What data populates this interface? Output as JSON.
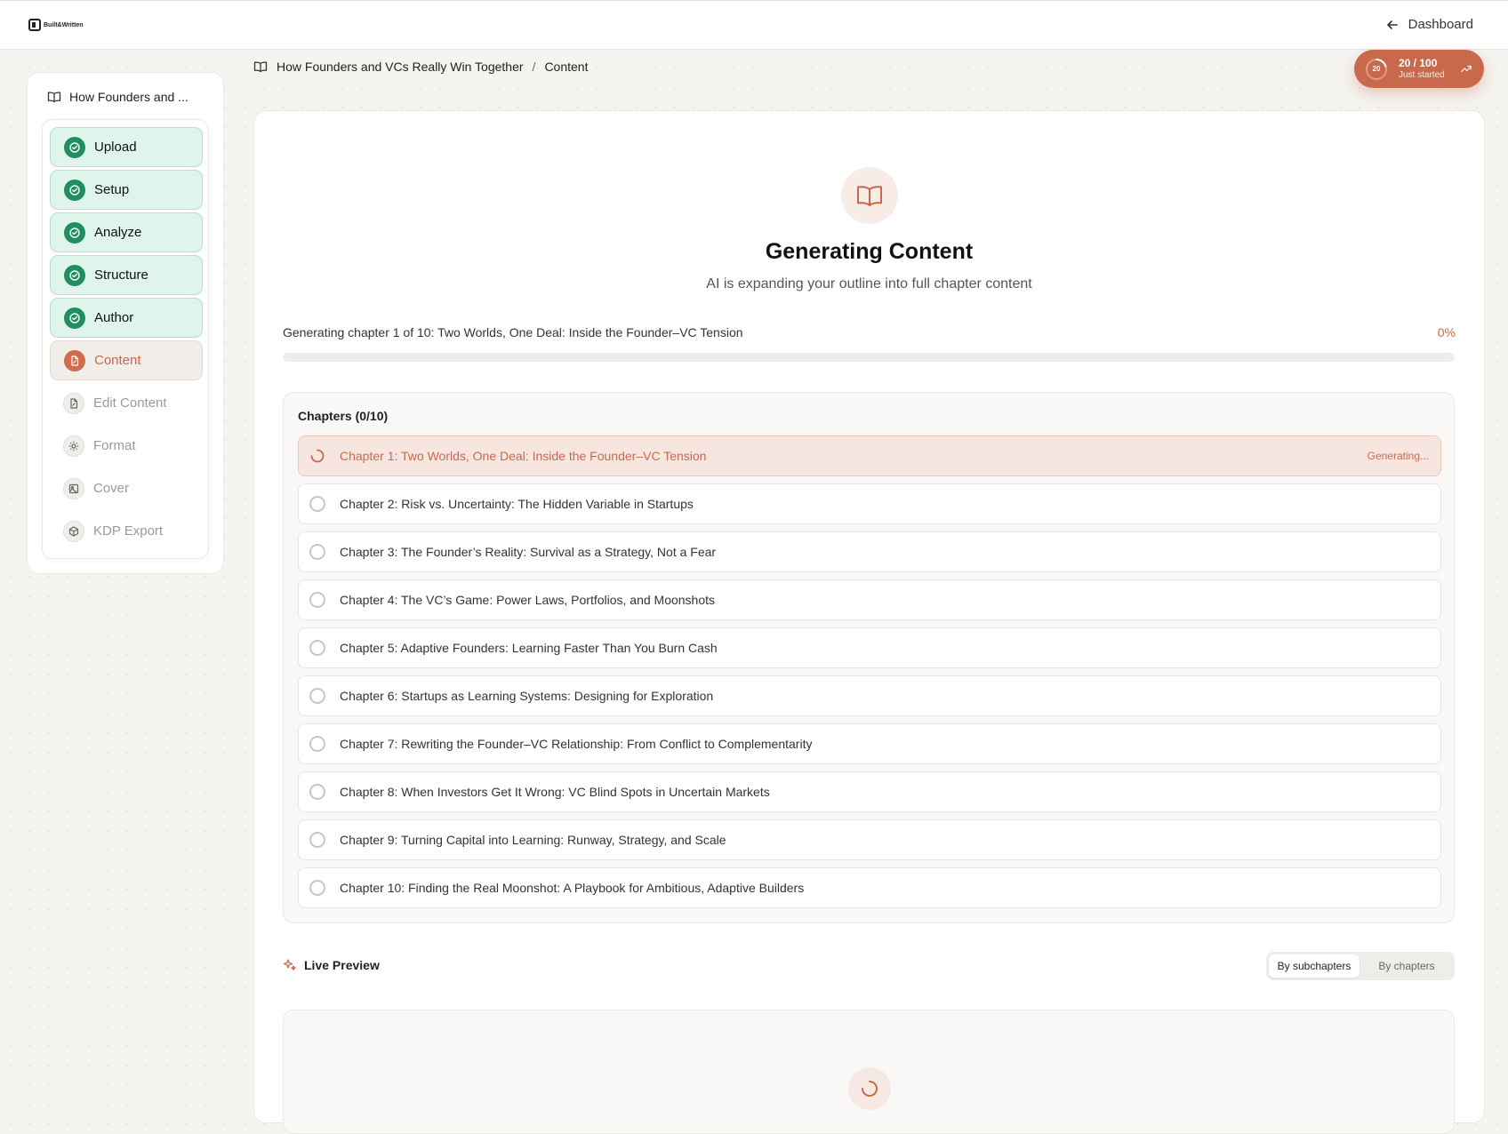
{
  "app": {
    "logo_text": "Built&Written",
    "dashboard_label": "Dashboard"
  },
  "score": {
    "value": "20",
    "label": "20 / 100",
    "status": "Just started",
    "progress": 0.2
  },
  "sidebar": {
    "book_title": "How Founders and ...",
    "steps": [
      {
        "label": "Upload",
        "state": "done"
      },
      {
        "label": "Setup",
        "state": "done"
      },
      {
        "label": "Analyze",
        "state": "done"
      },
      {
        "label": "Structure",
        "state": "done"
      },
      {
        "label": "Author",
        "state": "done"
      },
      {
        "label": "Content",
        "state": "active"
      },
      {
        "label": "Edit Content",
        "state": "todo"
      },
      {
        "label": "Format",
        "state": "todo"
      },
      {
        "label": "Cover",
        "state": "todo"
      },
      {
        "label": "KDP Export",
        "state": "todo"
      }
    ]
  },
  "breadcrumb": {
    "book": "How Founders and VCs Really Win Together",
    "separator": "/",
    "current": "Content"
  },
  "main": {
    "title": "Generating Content",
    "subtitle": "AI is expanding your outline into full chapter content",
    "generating_text": "Generating chapter 1 of 10: Two Worlds, One Deal: Inside the Founder–VC Tension",
    "percent_label": "0%",
    "progress": 0
  },
  "chapters": {
    "heading": "Chapters (0/10)",
    "items": [
      {
        "title": "Chapter 1: Two Worlds, One Deal: Inside the Founder–VC Tension",
        "status": "Generating..."
      },
      {
        "title": "Chapter 2: Risk vs. Uncertainty: The Hidden Variable in Startups",
        "status": ""
      },
      {
        "title": "Chapter 3: The Founder’s Reality: Survival as a Strategy, Not a Fear",
        "status": ""
      },
      {
        "title": "Chapter 4: The VC’s Game: Power Laws, Portfolios, and Moonshots",
        "status": ""
      },
      {
        "title": "Chapter 5: Adaptive Founders: Learning Faster Than You Burn Cash",
        "status": ""
      },
      {
        "title": "Chapter 6: Startups as Learning Systems: Designing for Exploration",
        "status": ""
      },
      {
        "title": "Chapter 7: Rewriting the Founder–VC Relationship: From Conflict to Complementarity",
        "status": ""
      },
      {
        "title": "Chapter 8: When Investors Get It Wrong: VC Blind Spots in Uncertain Markets",
        "status": ""
      },
      {
        "title": "Chapter 9: Turning Capital into Learning: Runway, Strategy, and Scale",
        "status": ""
      },
      {
        "title": "Chapter 10: Finding the Real Moonshot: A Playbook for Ambitious, Adaptive Builders",
        "status": ""
      }
    ]
  },
  "live_preview": {
    "title": "Live Preview",
    "options": [
      "By subchapters",
      "By chapters"
    ],
    "selected": "By subchapters"
  },
  "colors": {
    "accent": "#c9694c",
    "success": "#1f8f62",
    "success_bg": "#dff4ea"
  }
}
